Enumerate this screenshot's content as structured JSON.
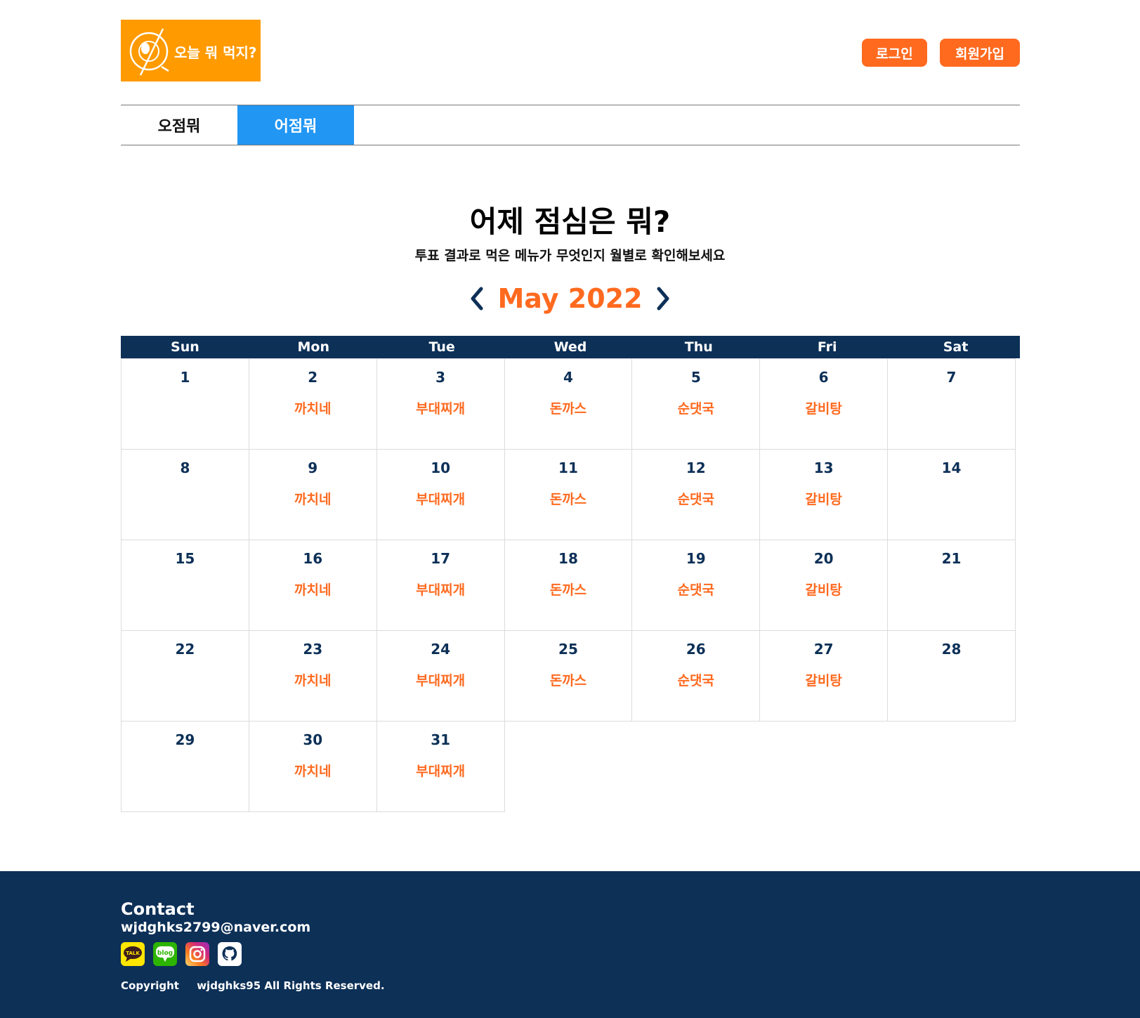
{
  "header": {
    "logo_text": "오늘 뭐 먹지?",
    "login_label": "로그인",
    "signup_label": "회원가입"
  },
  "tabs": [
    {
      "label": "오점뭐",
      "active": false
    },
    {
      "label": "어점뭐",
      "active": true
    }
  ],
  "page": {
    "title": "어제 점심은 뭐?",
    "subtitle": "투표 결과로 먹은 메뉴가 무엇인지 월별로 확인해보세요"
  },
  "calendar": {
    "month_label": "May 2022",
    "weekdays": [
      "Sun",
      "Mon",
      "Tue",
      "Wed",
      "Thu",
      "Fri",
      "Sat"
    ],
    "days": [
      {
        "day": "1",
        "menu": ""
      },
      {
        "day": "2",
        "menu": "까치네"
      },
      {
        "day": "3",
        "menu": "부대찌개"
      },
      {
        "day": "4",
        "menu": "돈까스"
      },
      {
        "day": "5",
        "menu": "순댓국"
      },
      {
        "day": "6",
        "menu": "갈비탕"
      },
      {
        "day": "7",
        "menu": ""
      },
      {
        "day": "8",
        "menu": ""
      },
      {
        "day": "9",
        "menu": "까치네"
      },
      {
        "day": "10",
        "menu": "부대찌개"
      },
      {
        "day": "11",
        "menu": "돈까스"
      },
      {
        "day": "12",
        "menu": "순댓국"
      },
      {
        "day": "13",
        "menu": "갈비탕"
      },
      {
        "day": "14",
        "menu": ""
      },
      {
        "day": "15",
        "menu": ""
      },
      {
        "day": "16",
        "menu": "까치네"
      },
      {
        "day": "17",
        "menu": "부대찌개"
      },
      {
        "day": "18",
        "menu": "돈까스"
      },
      {
        "day": "19",
        "menu": "순댓국"
      },
      {
        "day": "20",
        "menu": "갈비탕"
      },
      {
        "day": "21",
        "menu": ""
      },
      {
        "day": "22",
        "menu": ""
      },
      {
        "day": "23",
        "menu": "까치네"
      },
      {
        "day": "24",
        "menu": "부대찌개"
      },
      {
        "day": "25",
        "menu": "돈까스"
      },
      {
        "day": "26",
        "menu": "순댓국"
      },
      {
        "day": "27",
        "menu": "갈비탕"
      },
      {
        "day": "28",
        "menu": ""
      },
      {
        "day": "29",
        "menu": ""
      },
      {
        "day": "30",
        "menu": "까치네"
      },
      {
        "day": "31",
        "menu": "부대찌개"
      }
    ]
  },
  "footer": {
    "contact_label": "Contact",
    "email": "wjdghks2799@naver.com",
    "icons": [
      "kakaotalk-icon",
      "blog-icon",
      "instagram-icon",
      "github-icon"
    ],
    "kakao_text": "TALK",
    "blog_text": "blog",
    "copyright_label": "Copyright",
    "owner": "wjdghks95",
    "rights": "All Rights Reserved."
  },
  "colors": {
    "accent": "#ff6a1f",
    "logo_bg": "#ff9a00",
    "tab_active": "#2196f3",
    "navy": "#0d3057"
  }
}
